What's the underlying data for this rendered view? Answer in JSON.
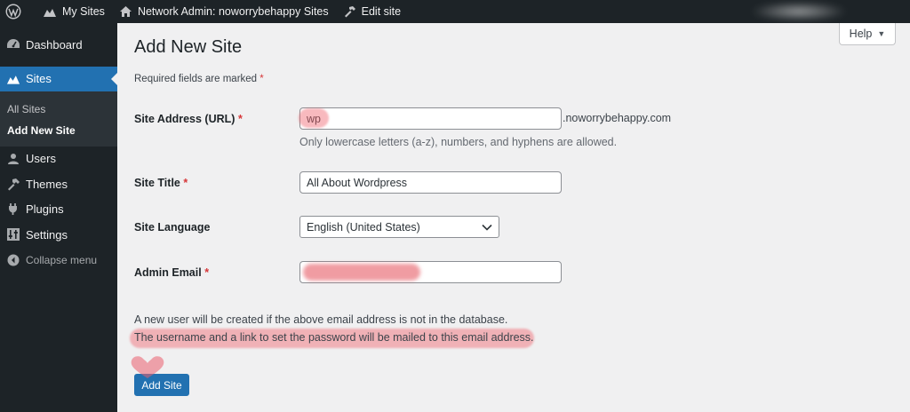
{
  "admin_bar": {
    "my_sites": "My Sites",
    "network_admin": "Network Admin: noworrybehappy Sites",
    "edit_site": "Edit site"
  },
  "sidebar": {
    "dashboard": "Dashboard",
    "sites": "Sites",
    "sub_all_sites": "All Sites",
    "sub_add_new_site": "Add New Site",
    "users": "Users",
    "themes": "Themes",
    "plugins": "Plugins",
    "settings": "Settings",
    "collapse": "Collapse menu"
  },
  "help": {
    "label": "Help"
  },
  "page": {
    "title": "Add New Site",
    "required_note": "Required fields are marked",
    "required_mark": "*"
  },
  "form": {
    "site_address": {
      "label": "Site Address (URL)",
      "value": "wp",
      "suffix": ".noworrybehappy.com",
      "description": "Only lowercase letters (a-z), numbers, and hyphens are allowed."
    },
    "site_title": {
      "label": "Site Title",
      "value": "All About Wordpress"
    },
    "site_language": {
      "label": "Site Language",
      "value": "English (United States)"
    },
    "admin_email": {
      "label": "Admin Email",
      "value": ""
    }
  },
  "notes": {
    "line1": "A new user will be created if the above email address is not in the database.",
    "line2": "The username and a link to set the password will be mailed to this email address."
  },
  "submit": {
    "label": "Add Site"
  },
  "colors": {
    "accent": "#2271b1",
    "admin_bg": "#1d2327",
    "required": "#d63638",
    "highlight": "#f0646e"
  }
}
